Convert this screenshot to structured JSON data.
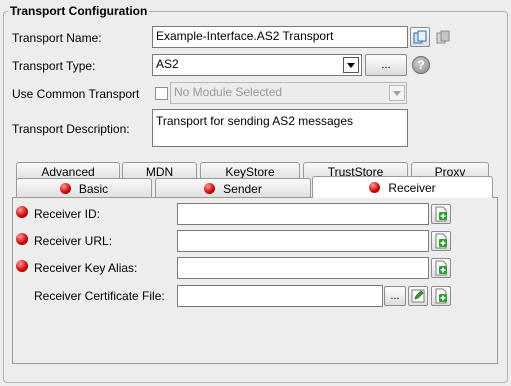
{
  "group": {
    "title": "Transport Configuration"
  },
  "transport_name": {
    "label": "Transport Name:",
    "value": "Example-Interface.AS2 Transport"
  },
  "transport_type": {
    "label": "Transport Type:",
    "value": "AS2",
    "browse_label": "...",
    "help_symbol": "?"
  },
  "use_common": {
    "label": "Use Common Transport",
    "checked": false,
    "select_value": "No Module Selected"
  },
  "description": {
    "label": "Transport Description:",
    "value": "Transport for sending AS2 messages"
  },
  "tabs_back": [
    "Advanced",
    "MDN",
    "KeyStore",
    "TrustStore",
    "Proxy"
  ],
  "tabs_front": [
    "Basic",
    "Sender",
    "Receiver"
  ],
  "selected_tab": "Receiver",
  "receiver": {
    "id_label": "Receiver ID:",
    "url_label": "Receiver URL:",
    "alias_label": "Receiver Key Alias:",
    "cert_label": "Receiver Certificate File:",
    "cert_browse": "...",
    "id_value": "",
    "url_value": "",
    "alias_value": "",
    "cert_value": ""
  },
  "colors": {
    "required_dot": "#cc0000",
    "add_icon": "#2e9d2e"
  }
}
